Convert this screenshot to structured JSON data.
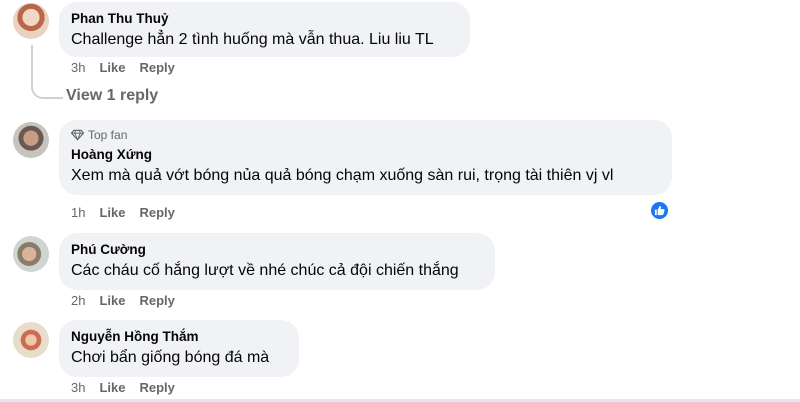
{
  "comments": [
    {
      "author": "Phan Thu Thuỷ",
      "text": "Challenge hẳn 2 tình huống mà vẫn thua. Liu liu TL",
      "time": "3h",
      "like_label": "Like",
      "reply_label": "Reply",
      "view_replies": "View 1 reply"
    },
    {
      "badge": "Top fan",
      "author": "Hoàng Xứng",
      "text": "Xem mà quả vớt bóng nủa quả bóng chạm xuống sàn rui, trọng tài thiên vj vl",
      "time": "1h",
      "like_label": "Like",
      "reply_label": "Reply",
      "reaction_icon": "thumbs-up-icon",
      "reaction_color": "#1877f2"
    },
    {
      "author": "Phú Cường",
      "text": "Các cháu cố hắng lượt về nhé chúc cả đội chiến thắng",
      "time": "2h",
      "like_label": "Like",
      "reply_label": "Reply"
    },
    {
      "author": "Nguyễn Hồng Thắm",
      "text": "Chơi bẩn giống bóng đá mà",
      "time": "3h",
      "like_label": "Like",
      "reply_label": "Reply"
    }
  ],
  "colors": {
    "bubble_bg": "#f0f2f5",
    "secondary_text": "#65676b",
    "primary_text": "#050505",
    "accent": "#1877f2"
  }
}
